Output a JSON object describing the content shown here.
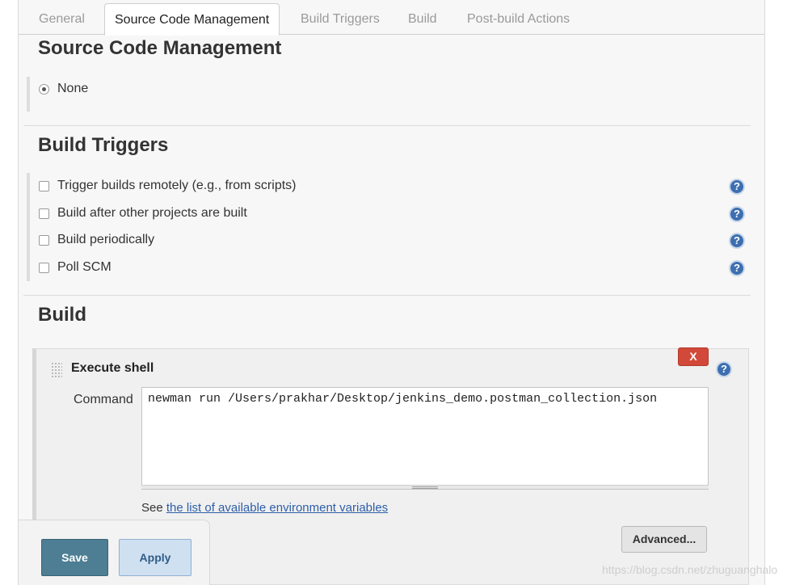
{
  "tabs": [
    {
      "label": "General"
    },
    {
      "label": "Source Code Management"
    },
    {
      "label": "Build Triggers"
    },
    {
      "label": "Build"
    },
    {
      "label": "Post-build Actions"
    }
  ],
  "active_tab": "Source Code Management",
  "scm": {
    "title": "Source Code Management",
    "option_none": "None",
    "selected": "None"
  },
  "triggers": {
    "title": "Build Triggers",
    "items": [
      {
        "label": "Trigger builds remotely (e.g., from scripts)",
        "checked": false
      },
      {
        "label": "Build after other projects are built",
        "checked": false
      },
      {
        "label": "Build periodically",
        "checked": false
      },
      {
        "label": "Poll SCM",
        "checked": false
      }
    ]
  },
  "build": {
    "title": "Build",
    "step_title": "Execute shell",
    "delete_label": "X",
    "command_label": "Command",
    "command_value": "newman run /Users/prakhar/Desktop/jenkins_demo.postman_collection.json",
    "see_prefix": "See ",
    "see_link": "the list of available environment variables",
    "advanced_label": "Advanced..."
  },
  "actions": {
    "save_label": "Save",
    "apply_label": "Apply"
  },
  "help_glyph": "?",
  "icons": {
    "help": "help-icon",
    "radio": "radio-icon",
    "checkbox": "checkbox-icon",
    "drag": "drag-handle-icon"
  },
  "colors": {
    "help_blue": "#3d6fb0",
    "delete_red": "#d24939",
    "save_teal": "#4d7e93",
    "apply_light_blue": "#cfe0f1",
    "link_blue": "#2d5ea8"
  },
  "watermark": "https://blog.csdn.net/zhuguanghalo"
}
